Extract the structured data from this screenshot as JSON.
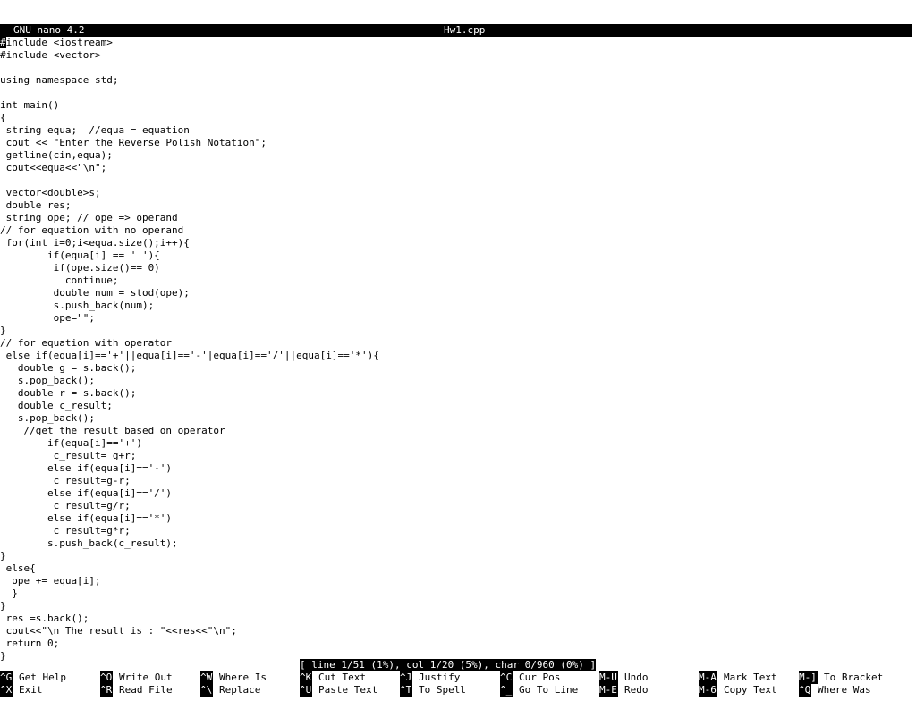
{
  "titlebar": {
    "app_name": "GNU nano 4.2",
    "file_name": "Hw1.cpp"
  },
  "editor": {
    "first_char": "#",
    "first_rest": "include <iostream>",
    "lines": [
      "#include <vector>",
      "",
      "using namespace std;",
      "",
      "int main()",
      "{",
      " string equa;  //equa = equation",
      " cout << \"Enter the Reverse Polish Notation\";",
      " getline(cin,equa);",
      " cout<<equa<<\"\\n\";",
      "",
      " vector<double>s;",
      " double res;",
      " string ope; // ope => operand",
      "// for equation with no operand",
      " for(int i=0;i<equa.size();i++){",
      "        if(equa[i] == ' '){",
      "         if(ope.size()== 0)",
      "           continue;",
      "         double num = stod(ope);",
      "         s.push_back(num);",
      "         ope=\"\";",
      "}",
      "// for equation with operator",
      " else if(equa[i]=='+'||equa[i]=='-'|equa[i]=='/'||equa[i]=='*'){",
      "   double g = s.back();",
      "   s.pop_back();",
      "   double r = s.back();",
      "   double c_result;",
      "   s.pop_back();",
      "    //get the result based on operator",
      "        if(equa[i]=='+')",
      "         c_result= g+r;",
      "        else if(equa[i]=='-')",
      "         c_result=g-r;",
      "        else if(equa[i]=='/')",
      "         c_result=g/r;",
      "        else if(equa[i]=='*')",
      "         c_result=g*r;",
      "        s.push_back(c_result);",
      "}",
      " else{",
      "  ope += equa[i];",
      "  }",
      "}",
      " res =s.back();",
      " cout<<\"\\n The result is : \"<<res<<\"\\n\";",
      " return 0;",
      "}"
    ]
  },
  "status": {
    "text": "[ line 1/51 (1%), col 1/20 (5%), char 0/960 (0%) ]"
  },
  "shortcuts": {
    "row1": [
      {
        "key": "^G",
        "label": "Get Help"
      },
      {
        "key": "^O",
        "label": "Write Out"
      },
      {
        "key": "^W",
        "label": "Where Is"
      },
      {
        "key": "^K",
        "label": "Cut Text"
      },
      {
        "key": "^J",
        "label": "Justify"
      },
      {
        "key": "^C",
        "label": "Cur Pos"
      },
      {
        "key": "M-U",
        "label": "Undo"
      },
      {
        "key": "M-A",
        "label": "Mark Text"
      },
      {
        "key": "M-]",
        "label": "To Bracket"
      }
    ],
    "row2": [
      {
        "key": "^X",
        "label": "Exit"
      },
      {
        "key": "^R",
        "label": "Read File"
      },
      {
        "key": "^\\",
        "label": "Replace"
      },
      {
        "key": "^U",
        "label": "Paste Text"
      },
      {
        "key": "^T",
        "label": "To Spell"
      },
      {
        "key": "^_",
        "label": "Go To Line"
      },
      {
        "key": "M-E",
        "label": "Redo"
      },
      {
        "key": "M-6",
        "label": "Copy Text"
      },
      {
        "key": "^Q",
        "label": "Where Was"
      }
    ]
  }
}
